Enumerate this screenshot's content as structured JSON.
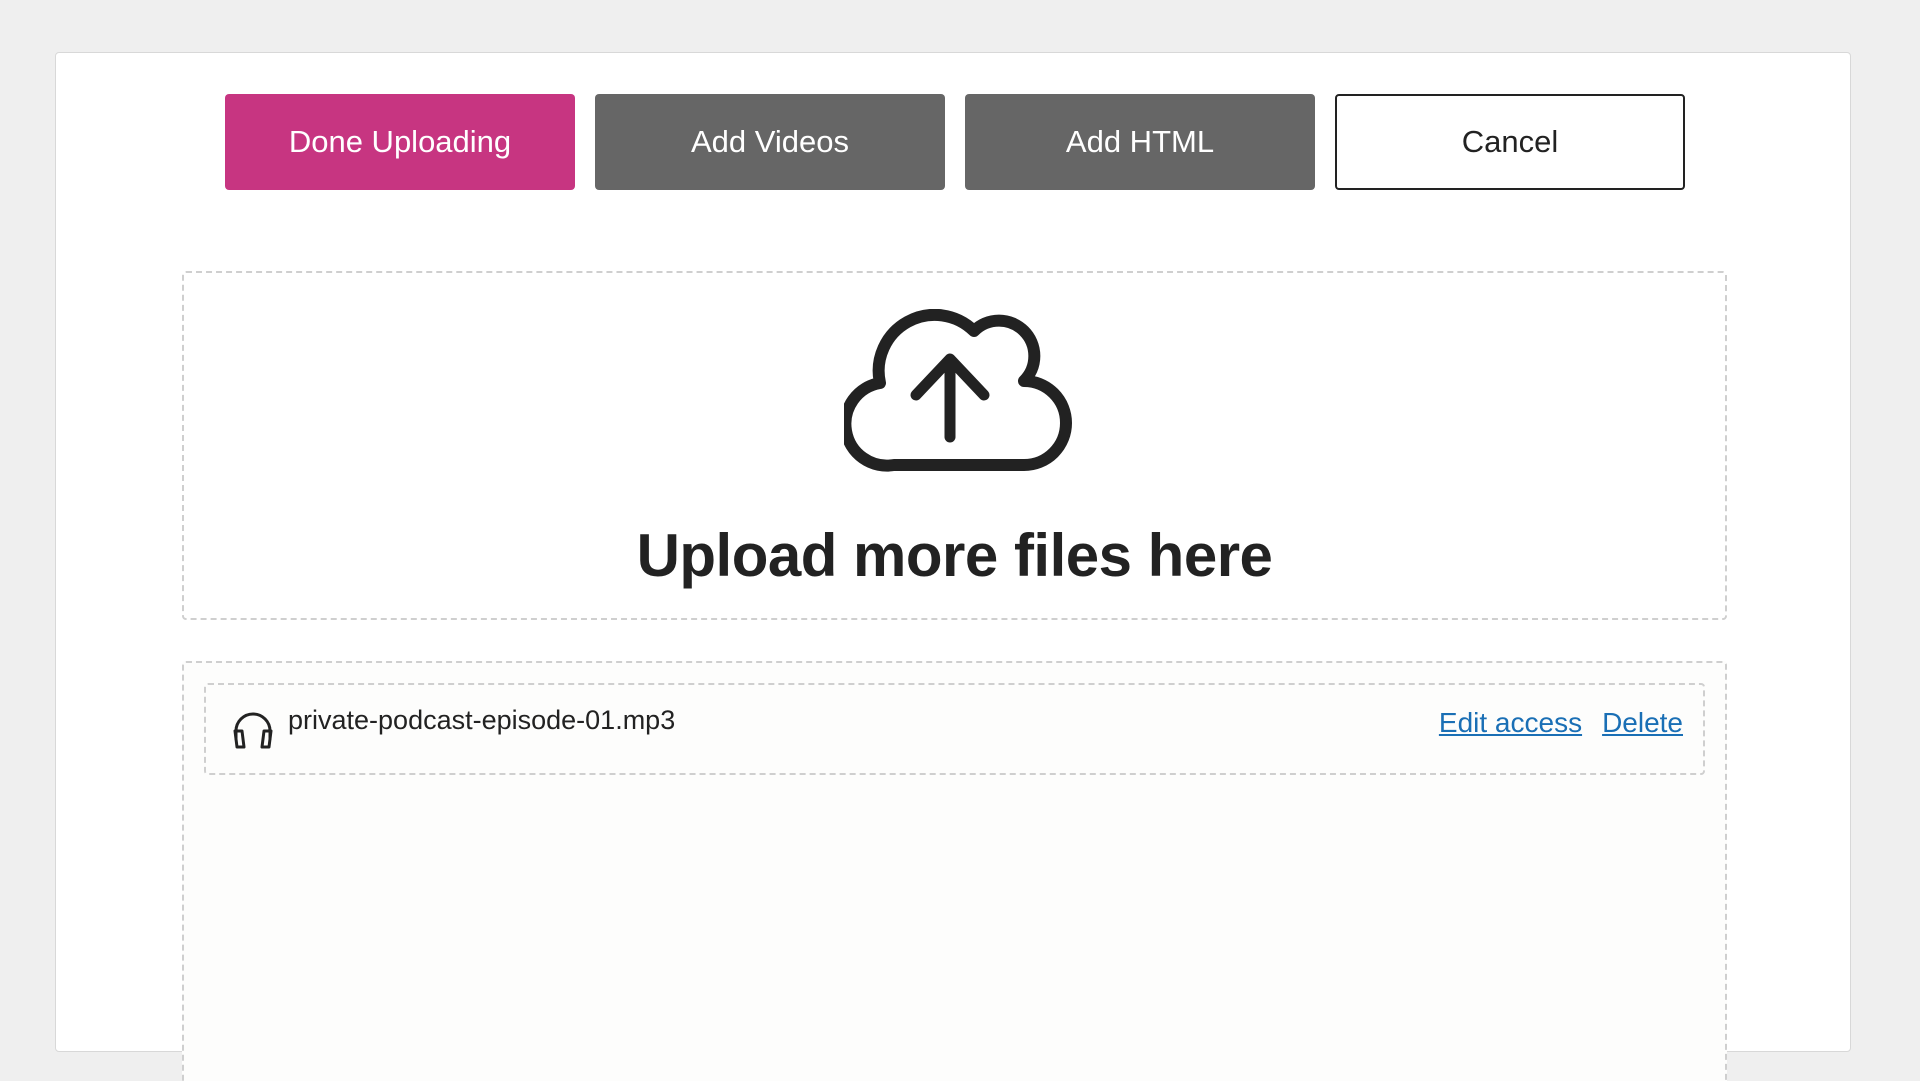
{
  "toolbar": {
    "done_label": "Done Uploading",
    "add_videos_label": "Add Videos",
    "add_html_label": "Add HTML",
    "cancel_label": "Cancel"
  },
  "dropzone": {
    "icon": "cloud-upload-icon",
    "heading": "Upload more files here"
  },
  "files": [
    {
      "icon": "headphones-icon",
      "name": "private-podcast-episode-01.mp3",
      "edit_label": "Edit access",
      "delete_label": "Delete"
    }
  ],
  "colors": {
    "primary": "#c73581",
    "secondary": "#666666",
    "link": "#1a6fb5"
  }
}
